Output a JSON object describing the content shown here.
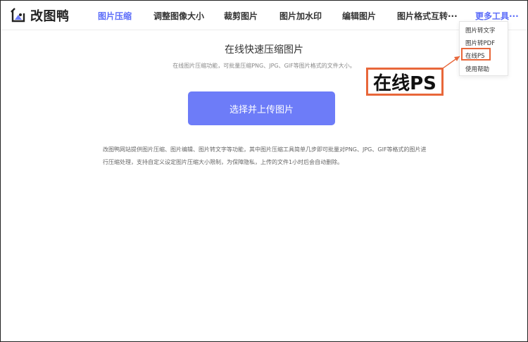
{
  "header": {
    "logo_text": "改图鸭",
    "nav": [
      {
        "label": "图片压缩",
        "active": true
      },
      {
        "label": "调整图像大小",
        "active": false
      },
      {
        "label": "裁剪图片",
        "active": false
      },
      {
        "label": "图片加水印",
        "active": false
      },
      {
        "label": "编辑图片",
        "active": false
      },
      {
        "label": "图片格式互转···",
        "active": false
      }
    ],
    "more_label": "更多工具···"
  },
  "dropdown": {
    "items": [
      "图片转文字",
      "图片转PDF",
      "在线PS",
      "使用帮助"
    ],
    "highlighted_index": 2
  },
  "callout": {
    "text": "在线PS",
    "color": "#e8673a"
  },
  "main": {
    "title": "在线快速压缩图片",
    "subtitle": "在线图片压缩功能，可批量压缩PNG、JPG、GIF等图片格式的文件大小。",
    "upload_label": "选择并上传图片",
    "description": "改图鸭网站提供图片压缩、图片编辑、图片转文字等功能，其中图片压缩工具简单几步即可批量对PNG、JPG、GIF等格式的图片进行压缩处理，支持自定义设定图片压缩大小限制，为保障隐私，上传的文件1小时后会自动删除。"
  },
  "colors": {
    "accent": "#5b6cf9",
    "button": "#6d7cf8",
    "highlight": "#e8673a"
  }
}
